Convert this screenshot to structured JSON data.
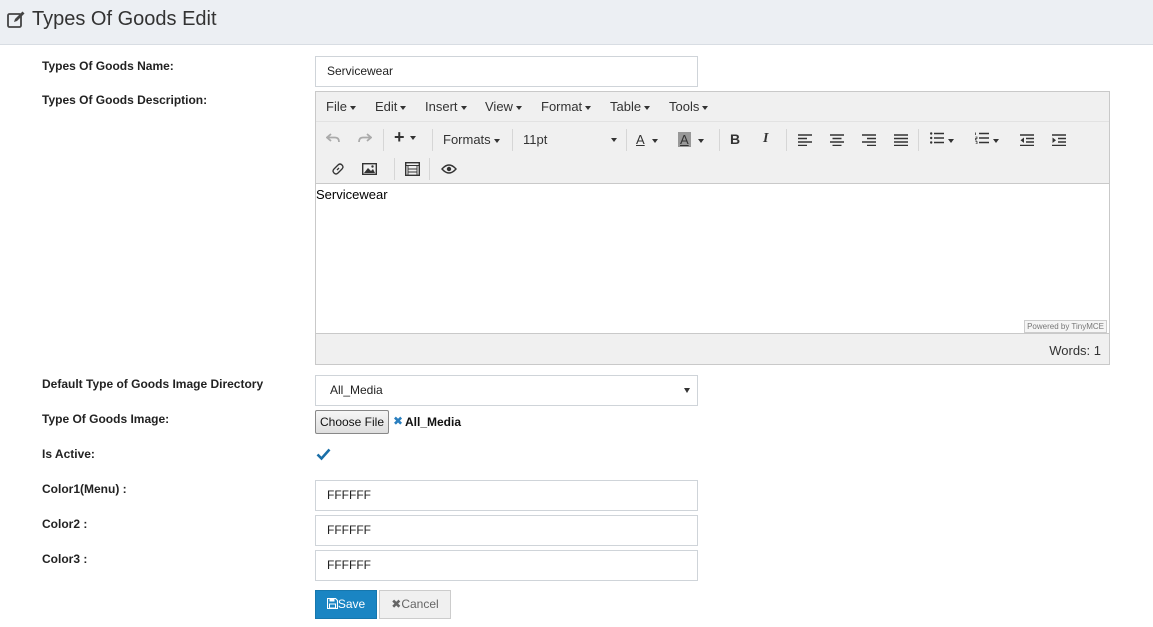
{
  "header": {
    "title": "Types Of Goods Edit",
    "icon": "edit-icon"
  },
  "form": {
    "name_label": "Types Of Goods Name:",
    "name_value": "Servicewear",
    "description_label": "Types Of Goods Description:",
    "directory_label": "Default Type of Goods Image Directory",
    "directory_value": "All_Media",
    "image_label": "Type Of Goods Image:",
    "choose_file_label": "Choose File",
    "file_name": "All_Media",
    "active_label": "Is Active:",
    "is_active": true,
    "color1_label": "Color1(Menu) :",
    "color1_value": "FFFFFF",
    "color2_label": "Color2 :",
    "color2_value": "FFFFFF",
    "color3_label": "Color3 :",
    "color3_value": "FFFFFF",
    "save_label": "Save",
    "cancel_label": "Cancel"
  },
  "editor": {
    "menu": [
      "File",
      "Edit",
      "Insert",
      "View",
      "Format",
      "Table",
      "Tools"
    ],
    "formats_label": "Formats",
    "font_size": "11pt",
    "content": "Servicewear",
    "powered_by": "Powered by TinyMCE",
    "word_count": "Words: 1"
  },
  "colors": {
    "accent": "#1a85c3",
    "header_bg": "#eceff3",
    "check": "#1a6fa8"
  }
}
